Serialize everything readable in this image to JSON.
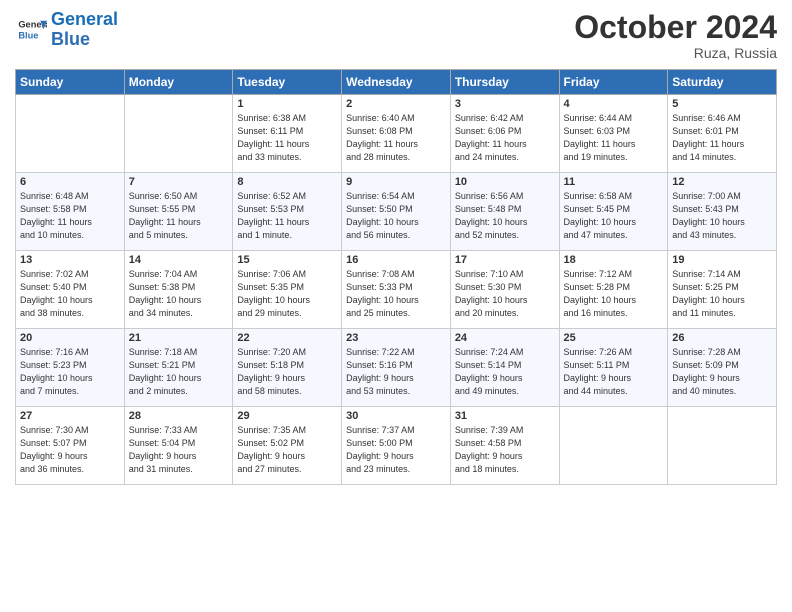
{
  "logo": {
    "line1": "General",
    "line2": "Blue"
  },
  "title": "October 2024",
  "location": "Ruza, Russia",
  "days_of_week": [
    "Sunday",
    "Monday",
    "Tuesday",
    "Wednesday",
    "Thursday",
    "Friday",
    "Saturday"
  ],
  "weeks": [
    [
      {
        "day": "",
        "detail": ""
      },
      {
        "day": "",
        "detail": ""
      },
      {
        "day": "1",
        "detail": "Sunrise: 6:38 AM\nSunset: 6:11 PM\nDaylight: 11 hours\nand 33 minutes."
      },
      {
        "day": "2",
        "detail": "Sunrise: 6:40 AM\nSunset: 6:08 PM\nDaylight: 11 hours\nand 28 minutes."
      },
      {
        "day": "3",
        "detail": "Sunrise: 6:42 AM\nSunset: 6:06 PM\nDaylight: 11 hours\nand 24 minutes."
      },
      {
        "day": "4",
        "detail": "Sunrise: 6:44 AM\nSunset: 6:03 PM\nDaylight: 11 hours\nand 19 minutes."
      },
      {
        "day": "5",
        "detail": "Sunrise: 6:46 AM\nSunset: 6:01 PM\nDaylight: 11 hours\nand 14 minutes."
      }
    ],
    [
      {
        "day": "6",
        "detail": "Sunrise: 6:48 AM\nSunset: 5:58 PM\nDaylight: 11 hours\nand 10 minutes."
      },
      {
        "day": "7",
        "detail": "Sunrise: 6:50 AM\nSunset: 5:55 PM\nDaylight: 11 hours\nand 5 minutes."
      },
      {
        "day": "8",
        "detail": "Sunrise: 6:52 AM\nSunset: 5:53 PM\nDaylight: 11 hours\nand 1 minute."
      },
      {
        "day": "9",
        "detail": "Sunrise: 6:54 AM\nSunset: 5:50 PM\nDaylight: 10 hours\nand 56 minutes."
      },
      {
        "day": "10",
        "detail": "Sunrise: 6:56 AM\nSunset: 5:48 PM\nDaylight: 10 hours\nand 52 minutes."
      },
      {
        "day": "11",
        "detail": "Sunrise: 6:58 AM\nSunset: 5:45 PM\nDaylight: 10 hours\nand 47 minutes."
      },
      {
        "day": "12",
        "detail": "Sunrise: 7:00 AM\nSunset: 5:43 PM\nDaylight: 10 hours\nand 43 minutes."
      }
    ],
    [
      {
        "day": "13",
        "detail": "Sunrise: 7:02 AM\nSunset: 5:40 PM\nDaylight: 10 hours\nand 38 minutes."
      },
      {
        "day": "14",
        "detail": "Sunrise: 7:04 AM\nSunset: 5:38 PM\nDaylight: 10 hours\nand 34 minutes."
      },
      {
        "day": "15",
        "detail": "Sunrise: 7:06 AM\nSunset: 5:35 PM\nDaylight: 10 hours\nand 29 minutes."
      },
      {
        "day": "16",
        "detail": "Sunrise: 7:08 AM\nSunset: 5:33 PM\nDaylight: 10 hours\nand 25 minutes."
      },
      {
        "day": "17",
        "detail": "Sunrise: 7:10 AM\nSunset: 5:30 PM\nDaylight: 10 hours\nand 20 minutes."
      },
      {
        "day": "18",
        "detail": "Sunrise: 7:12 AM\nSunset: 5:28 PM\nDaylight: 10 hours\nand 16 minutes."
      },
      {
        "day": "19",
        "detail": "Sunrise: 7:14 AM\nSunset: 5:25 PM\nDaylight: 10 hours\nand 11 minutes."
      }
    ],
    [
      {
        "day": "20",
        "detail": "Sunrise: 7:16 AM\nSunset: 5:23 PM\nDaylight: 10 hours\nand 7 minutes."
      },
      {
        "day": "21",
        "detail": "Sunrise: 7:18 AM\nSunset: 5:21 PM\nDaylight: 10 hours\nand 2 minutes."
      },
      {
        "day": "22",
        "detail": "Sunrise: 7:20 AM\nSunset: 5:18 PM\nDaylight: 9 hours\nand 58 minutes."
      },
      {
        "day": "23",
        "detail": "Sunrise: 7:22 AM\nSunset: 5:16 PM\nDaylight: 9 hours\nand 53 minutes."
      },
      {
        "day": "24",
        "detail": "Sunrise: 7:24 AM\nSunset: 5:14 PM\nDaylight: 9 hours\nand 49 minutes."
      },
      {
        "day": "25",
        "detail": "Sunrise: 7:26 AM\nSunset: 5:11 PM\nDaylight: 9 hours\nand 44 minutes."
      },
      {
        "day": "26",
        "detail": "Sunrise: 7:28 AM\nSunset: 5:09 PM\nDaylight: 9 hours\nand 40 minutes."
      }
    ],
    [
      {
        "day": "27",
        "detail": "Sunrise: 7:30 AM\nSunset: 5:07 PM\nDaylight: 9 hours\nand 36 minutes."
      },
      {
        "day": "28",
        "detail": "Sunrise: 7:33 AM\nSunset: 5:04 PM\nDaylight: 9 hours\nand 31 minutes."
      },
      {
        "day": "29",
        "detail": "Sunrise: 7:35 AM\nSunset: 5:02 PM\nDaylight: 9 hours\nand 27 minutes."
      },
      {
        "day": "30",
        "detail": "Sunrise: 7:37 AM\nSunset: 5:00 PM\nDaylight: 9 hours\nand 23 minutes."
      },
      {
        "day": "31",
        "detail": "Sunrise: 7:39 AM\nSunset: 4:58 PM\nDaylight: 9 hours\nand 18 minutes."
      },
      {
        "day": "",
        "detail": ""
      },
      {
        "day": "",
        "detail": ""
      }
    ]
  ]
}
